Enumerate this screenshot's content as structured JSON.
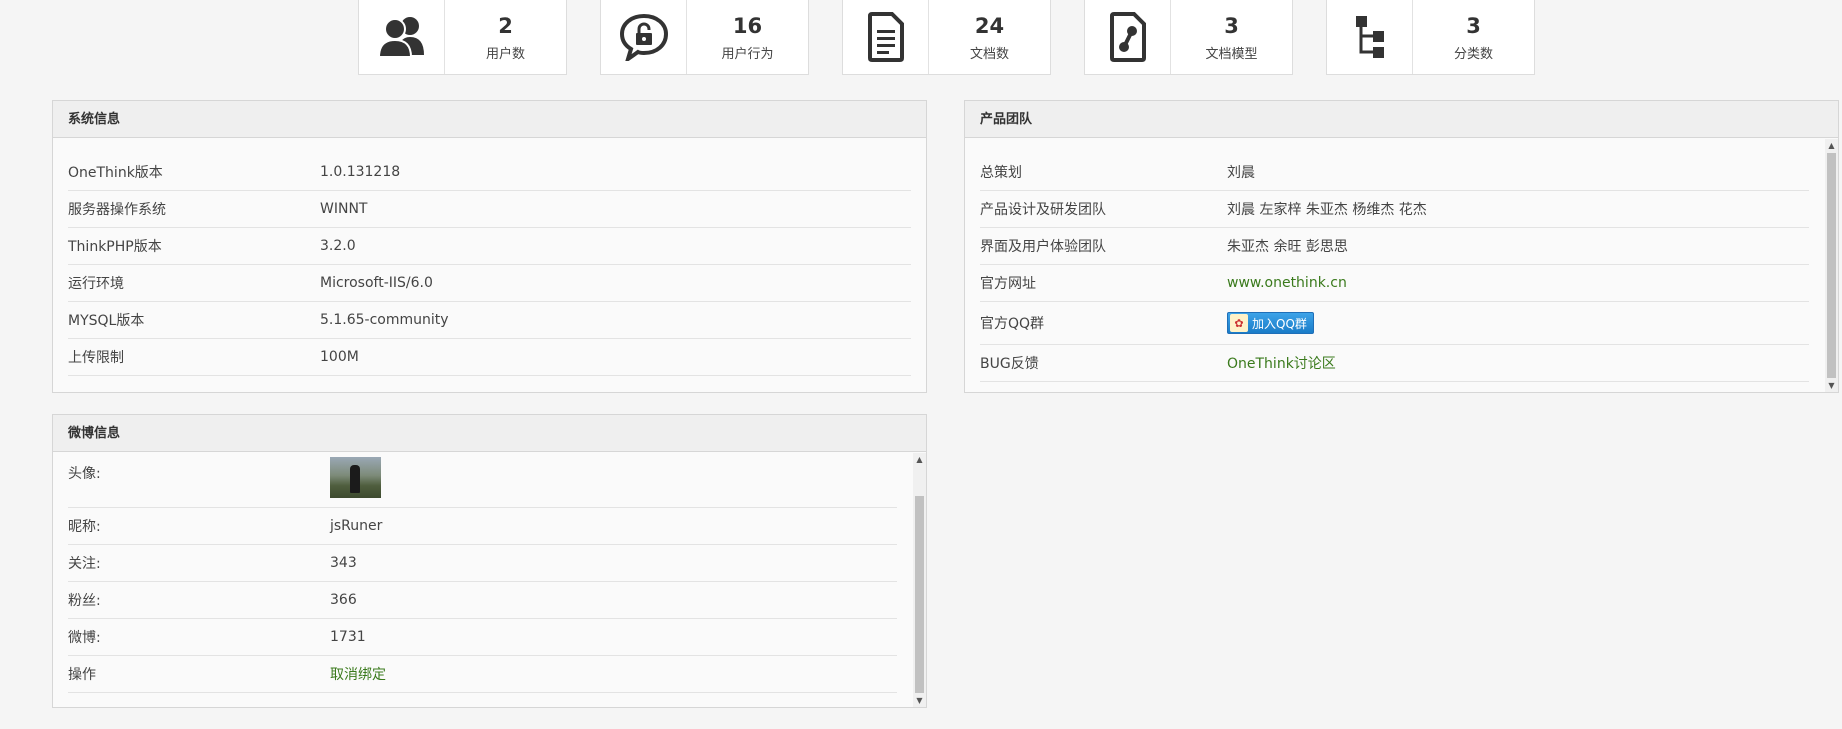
{
  "stats": [
    {
      "value": "2",
      "label": "用户数",
      "icon": "users-icon"
    },
    {
      "value": "16",
      "label": "用户行为",
      "icon": "lock-chat-icon"
    },
    {
      "value": "24",
      "label": "文档数",
      "icon": "document-icon"
    },
    {
      "value": "3",
      "label": "文档模型",
      "icon": "document-model-icon"
    },
    {
      "value": "3",
      "label": "分类数",
      "icon": "category-tree-icon"
    }
  ],
  "system": {
    "title": "系统信息",
    "rows": [
      {
        "key": "OneThink版本",
        "value": "1.0.131218"
      },
      {
        "key": "服务器操作系统",
        "value": "WINNT"
      },
      {
        "key": "ThinkPHP版本",
        "value": "3.2.0"
      },
      {
        "key": "运行环境",
        "value": "Microsoft-IIS/6.0"
      },
      {
        "key": "MYSQL版本",
        "value": "5.1.65-community"
      },
      {
        "key": "上传限制",
        "value": "100M"
      }
    ]
  },
  "team": {
    "title": "产品团队",
    "rows": [
      {
        "key": "总策划",
        "value": "刘晨"
      },
      {
        "key": "产品设计及研发团队",
        "value": "刘晨 左家梓 朱亚杰 杨维杰 花杰"
      },
      {
        "key": "界面及用户体验团队",
        "value": "朱亚杰 余旺 彭思思"
      },
      {
        "key": "官方网址",
        "value": "www.onethink.cn"
      },
      {
        "key": "官方QQ群",
        "value": "加入QQ群"
      },
      {
        "key": "BUG反馈",
        "value": "OneThink讨论区"
      }
    ]
  },
  "weibo": {
    "title": "微博信息",
    "rows": [
      {
        "key": "头像:",
        "value": ""
      },
      {
        "key": "昵称:",
        "value": "jsRuner"
      },
      {
        "key": "关注:",
        "value": "343"
      },
      {
        "key": "粉丝:",
        "value": "366"
      },
      {
        "key": "微博:",
        "value": "1731"
      },
      {
        "key": "操作",
        "value": "取消绑定"
      }
    ]
  },
  "colors": {
    "link": "#3a7a1c",
    "qq_button": "#1a7cc8"
  }
}
